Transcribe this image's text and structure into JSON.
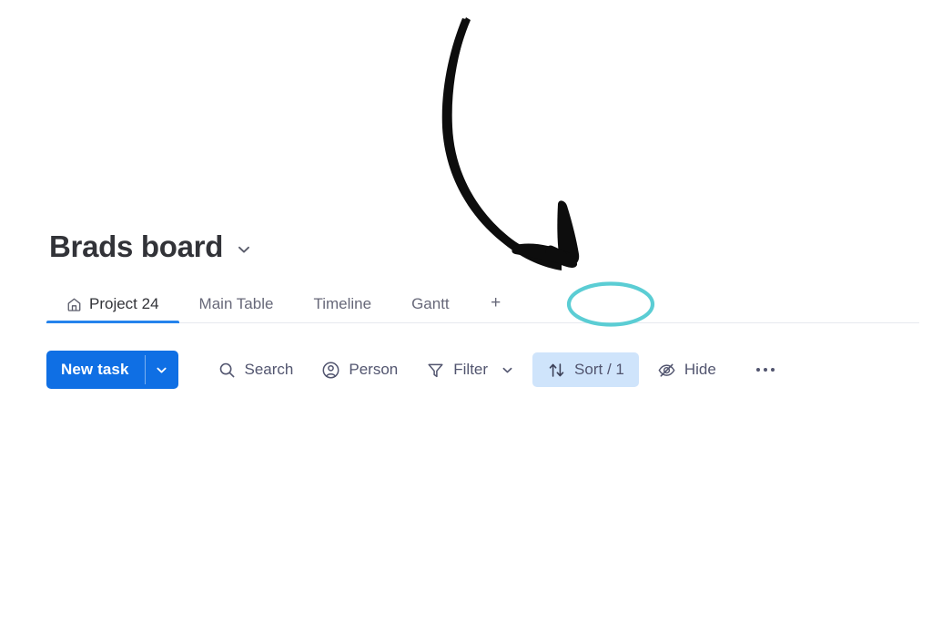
{
  "board": {
    "title": "Brads board",
    "title_chevron_icon": "chevron-down-icon"
  },
  "tabs": {
    "items": [
      {
        "label": "Project 24",
        "icon": "home-icon",
        "active": true
      },
      {
        "label": "Main Table",
        "icon": null,
        "active": false
      },
      {
        "label": "Timeline",
        "icon": null,
        "active": false
      },
      {
        "label": "Gantt",
        "icon": null,
        "active": false
      }
    ],
    "add_tab_label": "+",
    "add_tab_icon": "plus-icon",
    "active_underline_color": "#2683ec"
  },
  "toolbar": {
    "new_task_label": "New task",
    "new_task_caret_icon": "chevron-down-icon",
    "new_task_color": "#0f6fe4",
    "items": [
      {
        "label": "Search",
        "icon": "search-icon",
        "chevron": false,
        "highlighted": false
      },
      {
        "label": "Person",
        "icon": "person-circle-icon",
        "chevron": false,
        "highlighted": false
      },
      {
        "label": "Filter",
        "icon": "funnel-icon",
        "chevron": true,
        "highlighted": false
      },
      {
        "label": "Sort / 1",
        "icon": "sort-arrows-icon",
        "chevron": false,
        "highlighted": true
      },
      {
        "label": "Hide",
        "icon": "eye-off-icon",
        "chevron": false,
        "highlighted": false
      }
    ],
    "more_icon": "ellipsis-icon",
    "highlight_color": "#cfe4fb"
  },
  "annotation": {
    "arrow_icon": "curved-arrow-annotation",
    "arrow_color": "#0d0d0d",
    "highlight_icon": "ellipse-highlight-annotation",
    "highlight_color": "#5bcdd4",
    "highlight_target": "+"
  }
}
